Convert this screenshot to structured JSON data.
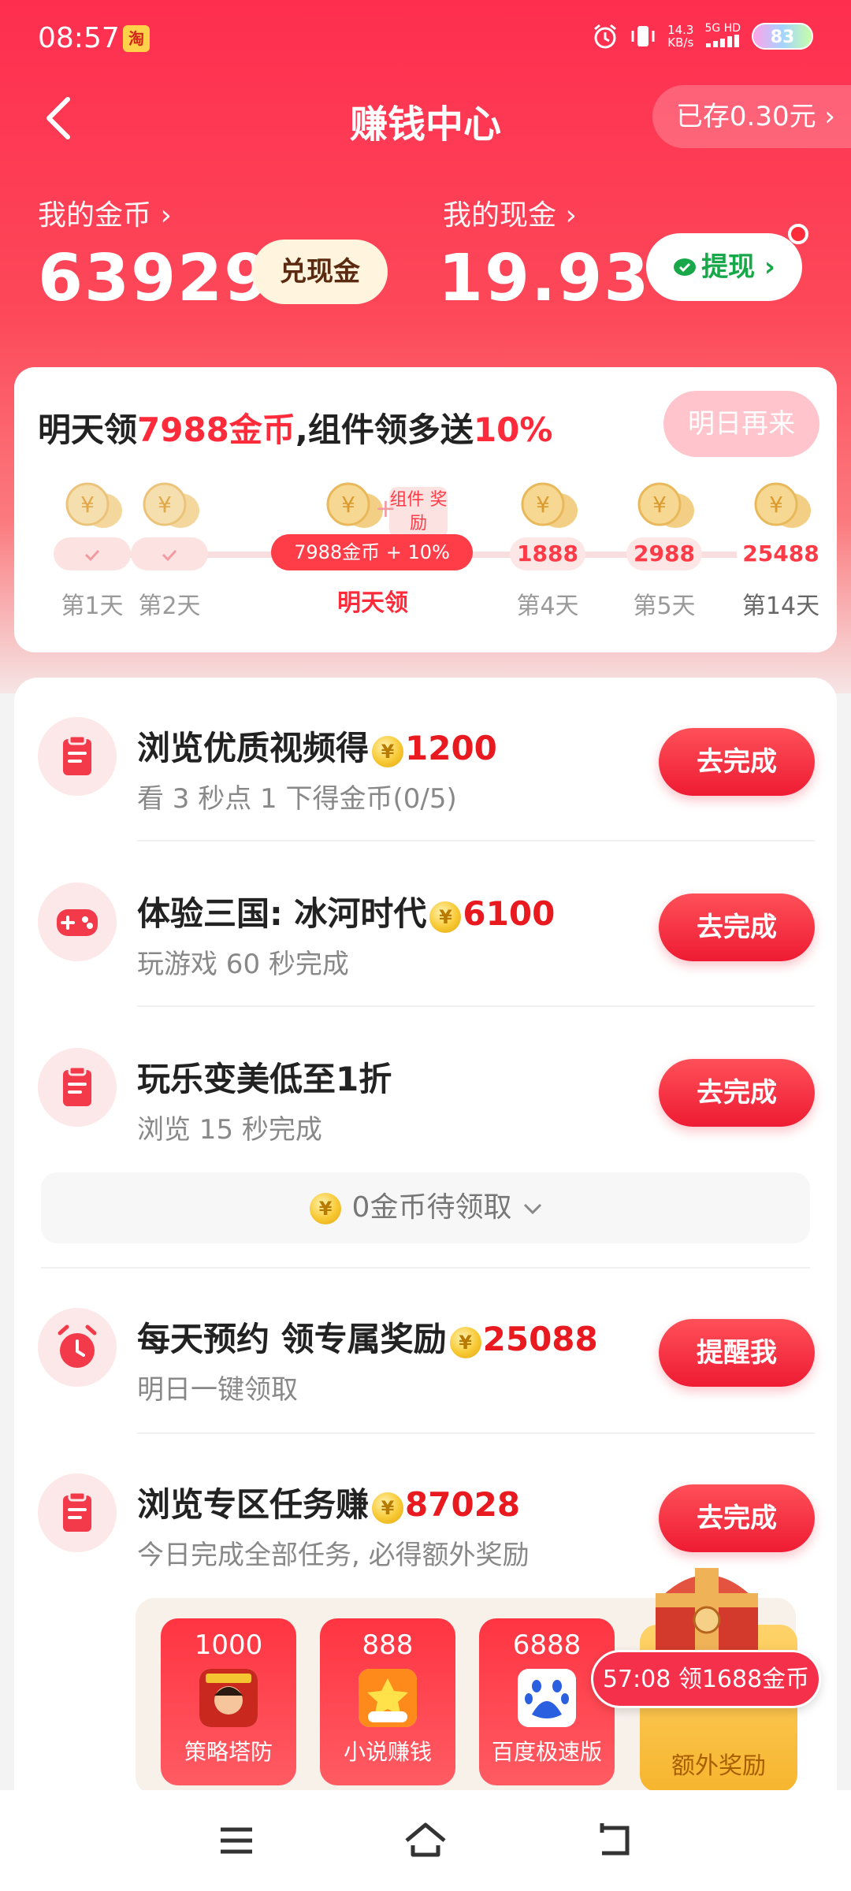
{
  "status_bar": {
    "time": "08:57",
    "app_icon": "淘",
    "net_speed_value": "14.3",
    "net_speed_unit": "KB/s",
    "network_type": "5G HD",
    "battery": "83",
    "icons": [
      "alarm-icon",
      "vibrate-icon",
      "signal-icon"
    ]
  },
  "header": {
    "title": "赚钱中心",
    "saved": "已存0.30元"
  },
  "balances": {
    "coins_label": "我的金币 ›",
    "coins_value": "63929",
    "redeem_label": "兑现金",
    "cash_label": "我的现金 ›",
    "cash_value": "19.93",
    "withdraw_label": "提现 ›"
  },
  "sign_in": {
    "headline_prefix": "明天领",
    "headline_coins": "7988金币",
    "headline_mid": ",组件领多送",
    "headline_pct": "10%",
    "button": "明日再来",
    "bonus_tag": "组件 奖励",
    "today_reward": "7988金币 + 10%",
    "days": [
      {
        "label": "第1天",
        "reward": "✓",
        "active": false
      },
      {
        "label": "第2天",
        "reward": "✓",
        "active": false
      },
      {
        "label": "明天领",
        "reward": "7988金币 + 10%",
        "active": true
      },
      {
        "label": "第4天",
        "reward": "1888",
        "active": false
      },
      {
        "label": "第5天",
        "reward": "2988",
        "active": false
      },
      {
        "label": "第14天",
        "reward": "25488",
        "active": false
      }
    ]
  },
  "tasks": [
    {
      "icon": "clipboard-icon",
      "title": "浏览优质视频得",
      "reward": "1200",
      "sub": "看 3 秒点 1 下得金币(0/5)",
      "button": "去完成"
    },
    {
      "icon": "gamepad-icon",
      "title": "体验三国: 冰河时代",
      "reward": "6100",
      "sub": "玩游戏 60 秒完成",
      "button": "去完成"
    },
    {
      "icon": "clipboard-icon",
      "title": "玩乐变美低至1折",
      "reward": "",
      "sub": "浏览 15 秒完成",
      "button": "去完成"
    },
    {
      "icon": "alarm-clock-icon",
      "title": "每天预约 领专属奖励",
      "reward": "25088",
      "sub": "明日一键领取",
      "button": "提醒我"
    },
    {
      "icon": "clipboard-icon",
      "title": "浏览专区任务赚",
      "reward": "87028",
      "sub": "今日完成全部任务, 必得额外奖励",
      "button": "去完成"
    }
  ],
  "pending": "0金币待领取",
  "mini_cards": [
    {
      "num": "1000",
      "name": "策略塔防"
    },
    {
      "num": "888",
      "name": "小说赚钱"
    },
    {
      "num": "6888",
      "name": "百度极速版"
    }
  ],
  "extra_reward": "额外奖励",
  "timer": "57:08 领1688金币",
  "colors": {
    "brand_red": "#fe2e4f",
    "button_red": "#ee1b33",
    "coin_gold": "#f7c832"
  }
}
